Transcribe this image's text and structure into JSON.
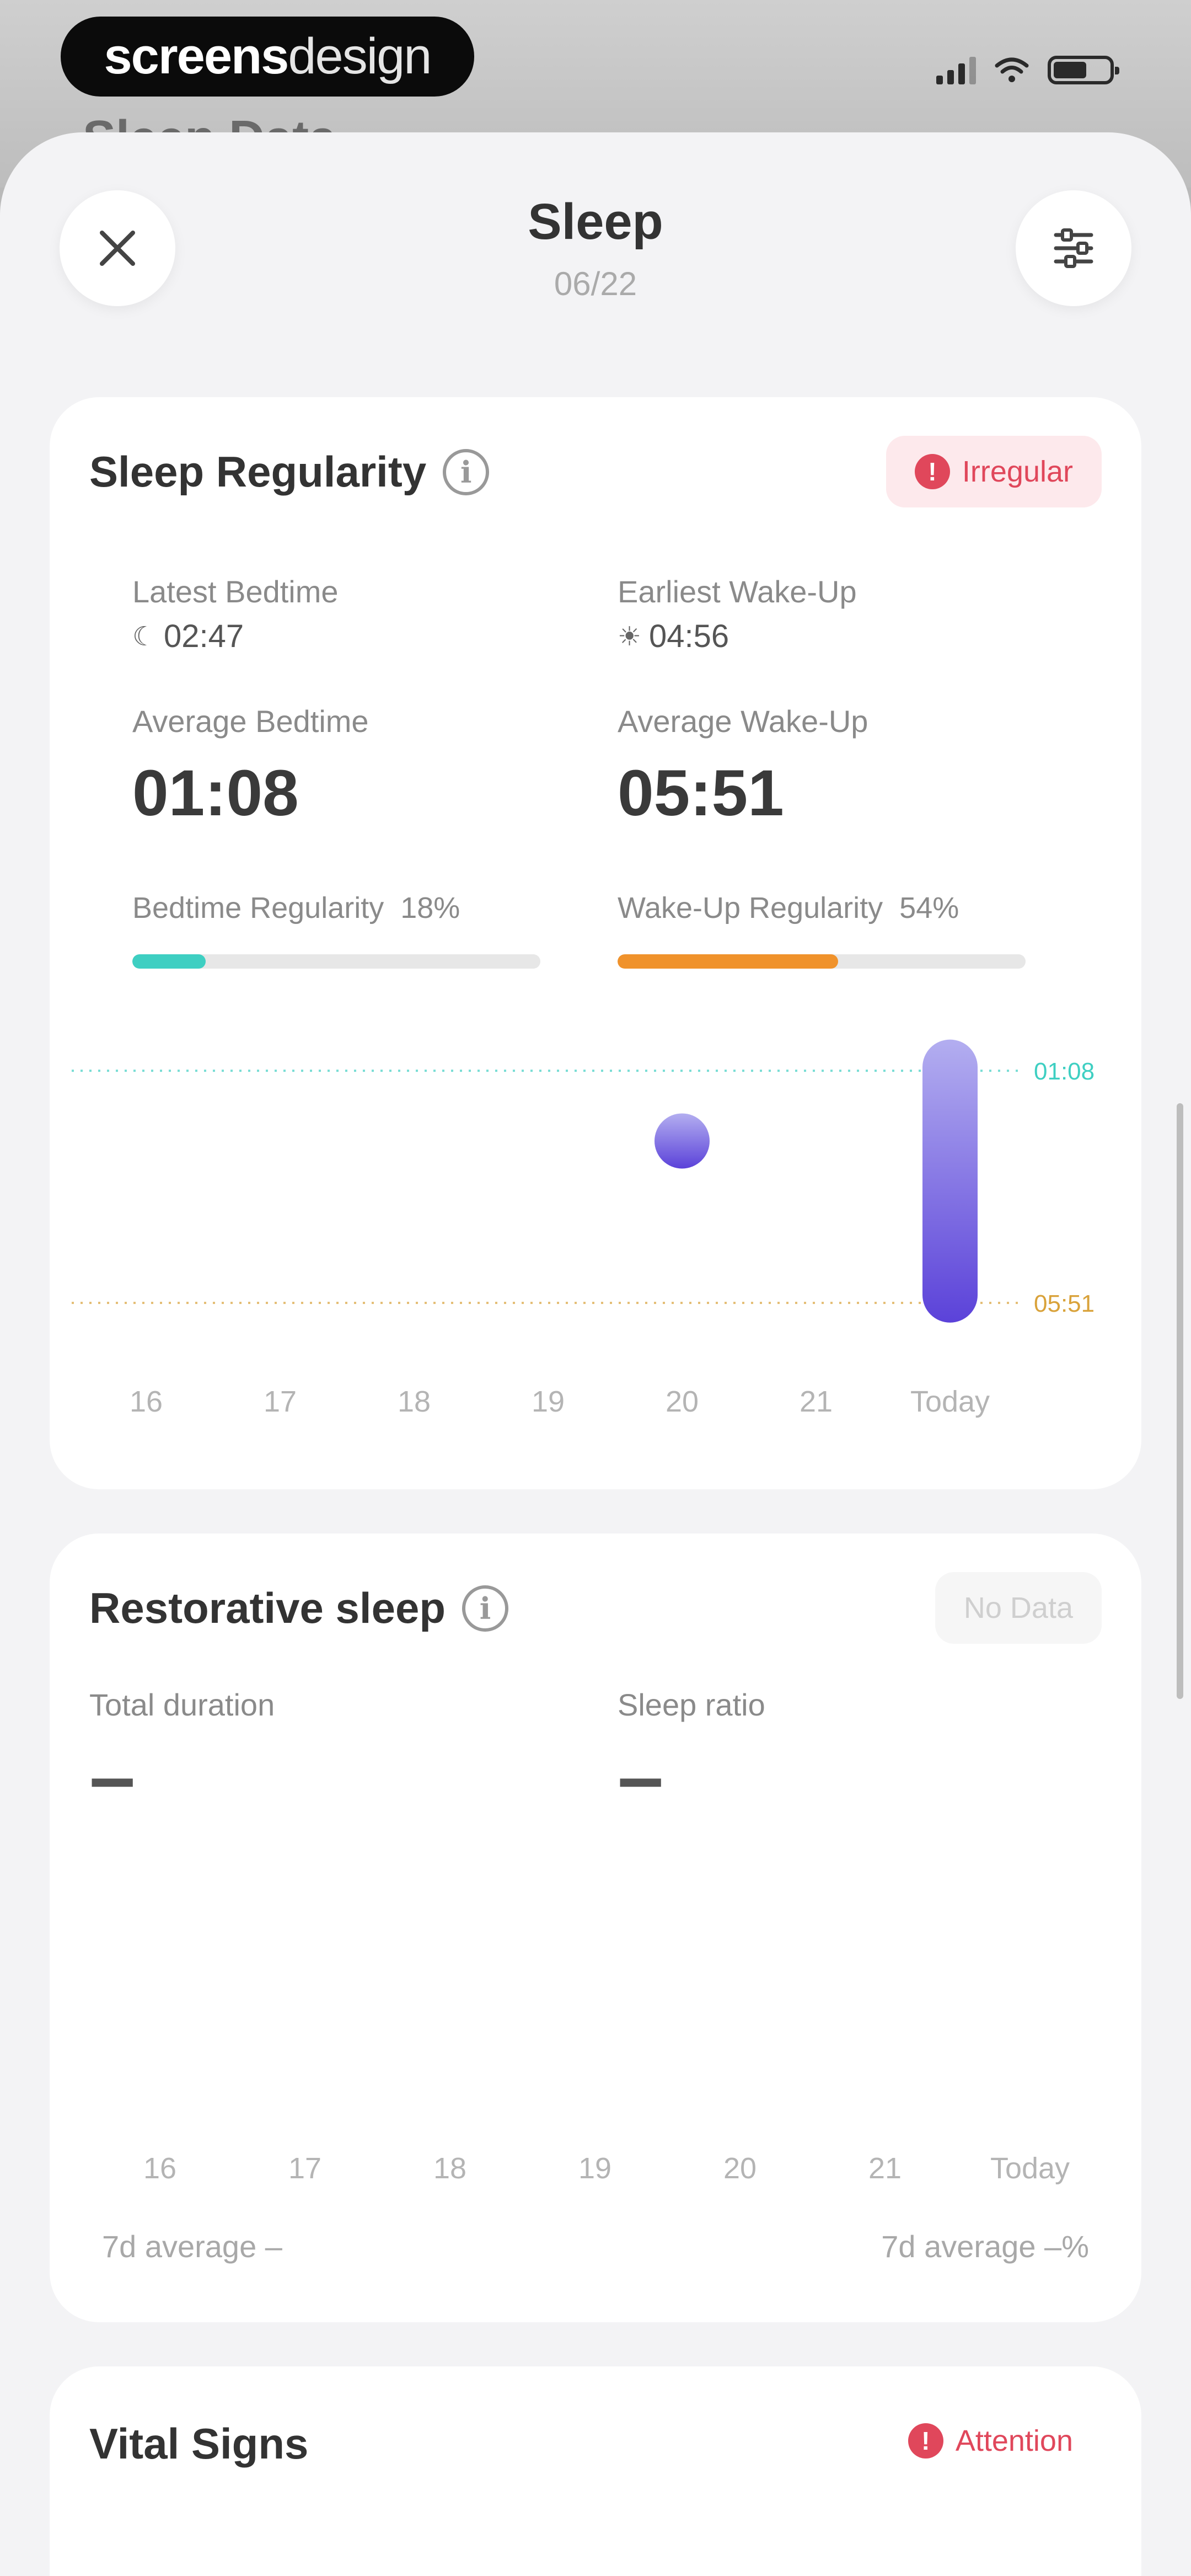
{
  "brand": {
    "bold": "screens",
    "light": "design"
  },
  "backdrop_title": "Sleep Data",
  "header": {
    "title": "Sleep",
    "date": "06/22"
  },
  "regularity": {
    "title": "Sleep Regularity",
    "badge": "Irregular",
    "latest_bedtime": {
      "label": "Latest Bedtime",
      "value": "02:47"
    },
    "earliest_wakeup": {
      "label": "Earliest Wake-Up",
      "value": "04:56"
    },
    "average_bedtime": {
      "label": "Average Bedtime",
      "value": "01:08"
    },
    "average_wakeup": {
      "label": "Average Wake-Up",
      "value": "05:51"
    },
    "bedtime_regularity": {
      "label": "Bedtime Regularity",
      "percent_text": "18%",
      "percent": 18
    },
    "wakeup_regularity": {
      "label": "Wake-Up Regularity",
      "percent_text": "54%",
      "percent": 54
    },
    "colors": {
      "bedtime": "#3ecfc2",
      "wakeup": "#f0922b",
      "bar_top": "#b3aef0",
      "bar_bottom": "#5b42d9"
    }
  },
  "chart_data": {
    "type": "bar",
    "categories": [
      "16",
      "17",
      "18",
      "19",
      "20",
      "21",
      "Today"
    ],
    "bars": [
      null,
      null,
      null,
      null,
      {
        "start": "02:00",
        "end": "03:00"
      },
      null,
      {
        "start": "00:30",
        "end": "06:15"
      }
    ],
    "ref_lines": [
      {
        "label": "01:08",
        "value": "01:08",
        "color": "#3ecfc2"
      },
      {
        "label": "05:51",
        "value": "05:51",
        "color": "#d9a23a"
      }
    ]
  },
  "restorative": {
    "title": "Restorative sleep",
    "badge": "No Data",
    "total_duration_label": "Total duration",
    "total_duration_value": "–",
    "sleep_ratio_label": "Sleep ratio",
    "sleep_ratio_value": "–",
    "days": [
      "16",
      "17",
      "18",
      "19",
      "20",
      "21",
      "Today"
    ],
    "avg_left": "7d average –",
    "avg_right": "7d average –%"
  },
  "vital": {
    "title": "Vital Signs",
    "badge": "Attention"
  }
}
